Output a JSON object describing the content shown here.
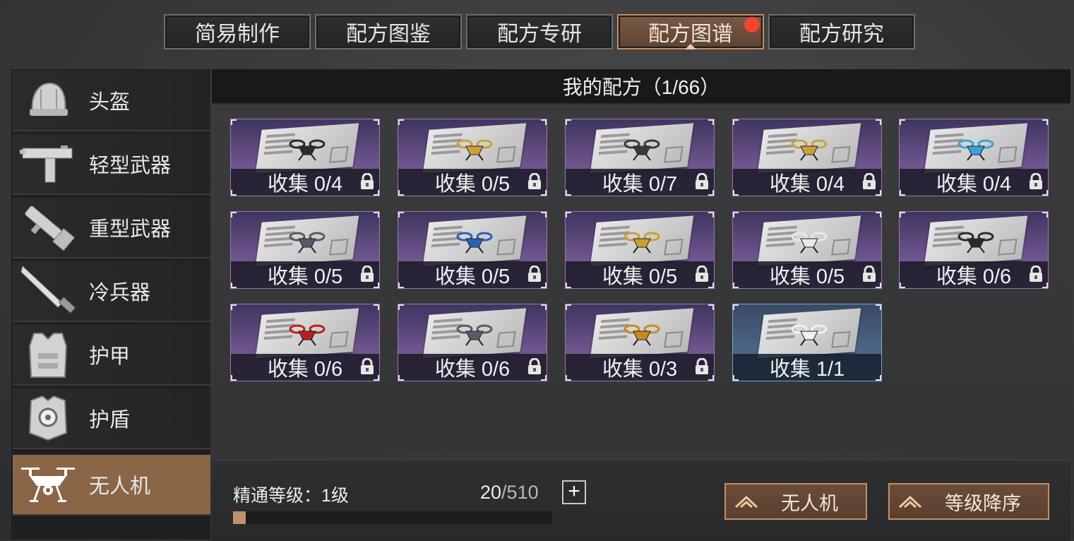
{
  "tabs": [
    {
      "label": "简易制作",
      "active": false
    },
    {
      "label": "配方图鉴",
      "active": false
    },
    {
      "label": "配方专研",
      "active": false
    },
    {
      "label": "配方图谱",
      "active": true,
      "notification": true
    },
    {
      "label": "配方研究",
      "active": false
    }
  ],
  "sidebar": {
    "items": [
      {
        "label": "头盔",
        "icon": "helmet-icon",
        "active": false
      },
      {
        "label": "轻型武器",
        "icon": "smg-icon",
        "active": false
      },
      {
        "label": "重型武器",
        "icon": "rocket-launcher-icon",
        "active": false
      },
      {
        "label": "冷兵器",
        "icon": "blade-icon",
        "active": false
      },
      {
        "label": "护甲",
        "icon": "vest-icon",
        "active": false
      },
      {
        "label": "护盾",
        "icon": "shield-icon",
        "active": false
      },
      {
        "label": "无人机",
        "icon": "drone-icon",
        "active": true
      }
    ]
  },
  "main": {
    "header": "我的配方（1/66）",
    "cards": [
      {
        "label": "收集 0/4",
        "locked": true,
        "collected": false,
        "color": "#2b2b2b"
      },
      {
        "label": "收集 0/5",
        "locked": true,
        "collected": false,
        "color": "#c9a23a"
      },
      {
        "label": "收集 0/7",
        "locked": true,
        "collected": false,
        "color": "#3a3a3a"
      },
      {
        "label": "收集 0/4",
        "locked": true,
        "collected": false,
        "color": "#c8a040"
      },
      {
        "label": "收集 0/4",
        "locked": true,
        "collected": false,
        "color": "#3aa0d8"
      },
      {
        "label": "收集 0/5",
        "locked": true,
        "collected": false,
        "color": "#555a66"
      },
      {
        "label": "收集 0/5",
        "locked": true,
        "collected": false,
        "color": "#2e5fb8"
      },
      {
        "label": "收集 0/5",
        "locked": true,
        "collected": false,
        "color": "#c8a030"
      },
      {
        "label": "收集 0/5",
        "locked": true,
        "collected": false,
        "color": "#e8e8e8"
      },
      {
        "label": "收集 0/6",
        "locked": true,
        "collected": false,
        "color": "#2b2b2b"
      },
      {
        "label": "收集 0/6",
        "locked": true,
        "collected": false,
        "color": "#b82020"
      },
      {
        "label": "收集 0/6",
        "locked": true,
        "collected": false,
        "color": "#5a5a6a"
      },
      {
        "label": "收集 0/3",
        "locked": true,
        "collected": false,
        "color": "#c88a20"
      },
      {
        "label": "收集 1/1",
        "locked": false,
        "collected": true,
        "color": "#f0f0f0"
      }
    ]
  },
  "mastery": {
    "label": "精通等级：1级",
    "current": "20",
    "max": "/510",
    "progress": 0.04,
    "plus": "+"
  },
  "filters": {
    "category": "无人机",
    "sort": "等级降序"
  },
  "colors": {
    "accent": "#c88e5f",
    "active_bg": "#8a6546",
    "notification": "#f0452e"
  }
}
